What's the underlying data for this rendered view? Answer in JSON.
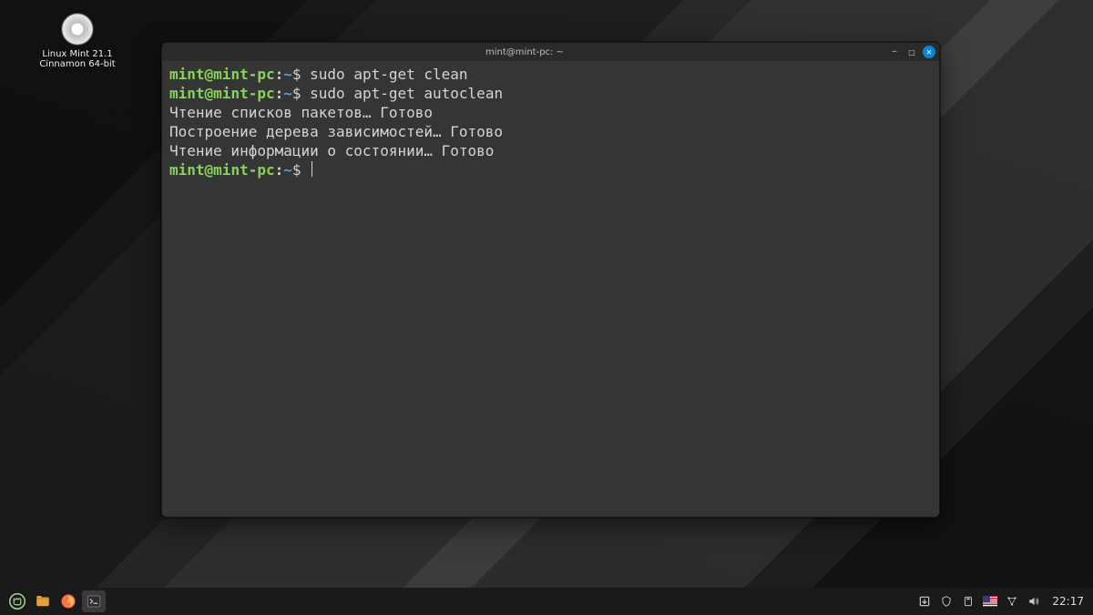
{
  "desktop": {
    "icon_label_line1": "Linux Mint 21.1",
    "icon_label_line2": "Cinnamon 64-bit"
  },
  "window": {
    "title": "mint@mint-pc: ~"
  },
  "terminal": {
    "prompt": {
      "user": "mint",
      "at": "@",
      "host": "mint-pc",
      "colon": ":",
      "path": "~",
      "dollar": "$ "
    },
    "lines": [
      {
        "type": "cmd",
        "text": "sudo apt-get clean"
      },
      {
        "type": "cmd",
        "text": "sudo apt-get autoclean"
      },
      {
        "type": "out",
        "text": "Чтение списков пакетов… Готово"
      },
      {
        "type": "out",
        "text": "Построение дерева зависимостей… Готово"
      },
      {
        "type": "out",
        "text": "Чтение информации о состоянии… Готово"
      },
      {
        "type": "prompt_only"
      }
    ]
  },
  "panel": {
    "clock": "22:17"
  }
}
